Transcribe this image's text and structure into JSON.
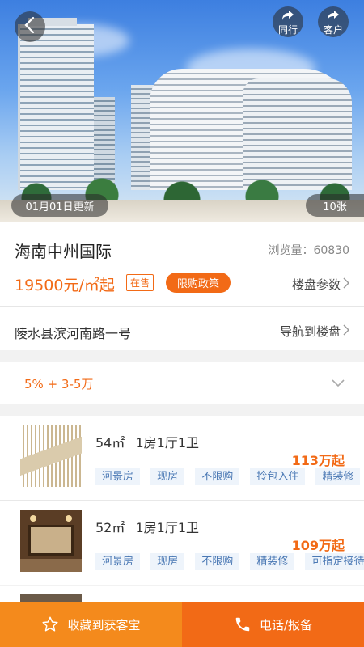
{
  "hero": {
    "update_label": "01月01日更新",
    "photo_count": "10张",
    "share_peer_label": "同行",
    "share_client_label": "客户"
  },
  "info": {
    "title": "海南中州国际",
    "views": "浏览量：60830",
    "price": "19500元/㎡起",
    "status": "在售",
    "policy": "限购政策",
    "params_label": "楼盘参数",
    "address": "陵水县滨河南路一号",
    "nav_label": "导航到楼盘"
  },
  "promo": {
    "text": "5% + 3-5万"
  },
  "units": [
    {
      "area": "54㎡",
      "layout": "1房1厅1卫",
      "price": "113万起",
      "tags": [
        "河景房",
        "现房",
        "不限购",
        "拎包入住",
        "精装修"
      ]
    },
    {
      "area": "52㎡",
      "layout": "1房1厅1卫",
      "price": "109万起",
      "tags": [
        "河景房",
        "现房",
        "不限购",
        "精装修",
        "可指定接待"
      ]
    }
  ],
  "bottom": {
    "favorite_label": "收藏到获客宝",
    "call_label": "电话/报备"
  },
  "colors": {
    "accent": "#f26a16",
    "favorite_bg": "#f48a1c",
    "tag_text": "#4a78b4",
    "tag_bg": "#eef4fb"
  },
  "icons": [
    "back-icon",
    "share-icon",
    "chevron-right-icon",
    "chevron-down-icon",
    "star-icon",
    "phone-icon"
  ]
}
